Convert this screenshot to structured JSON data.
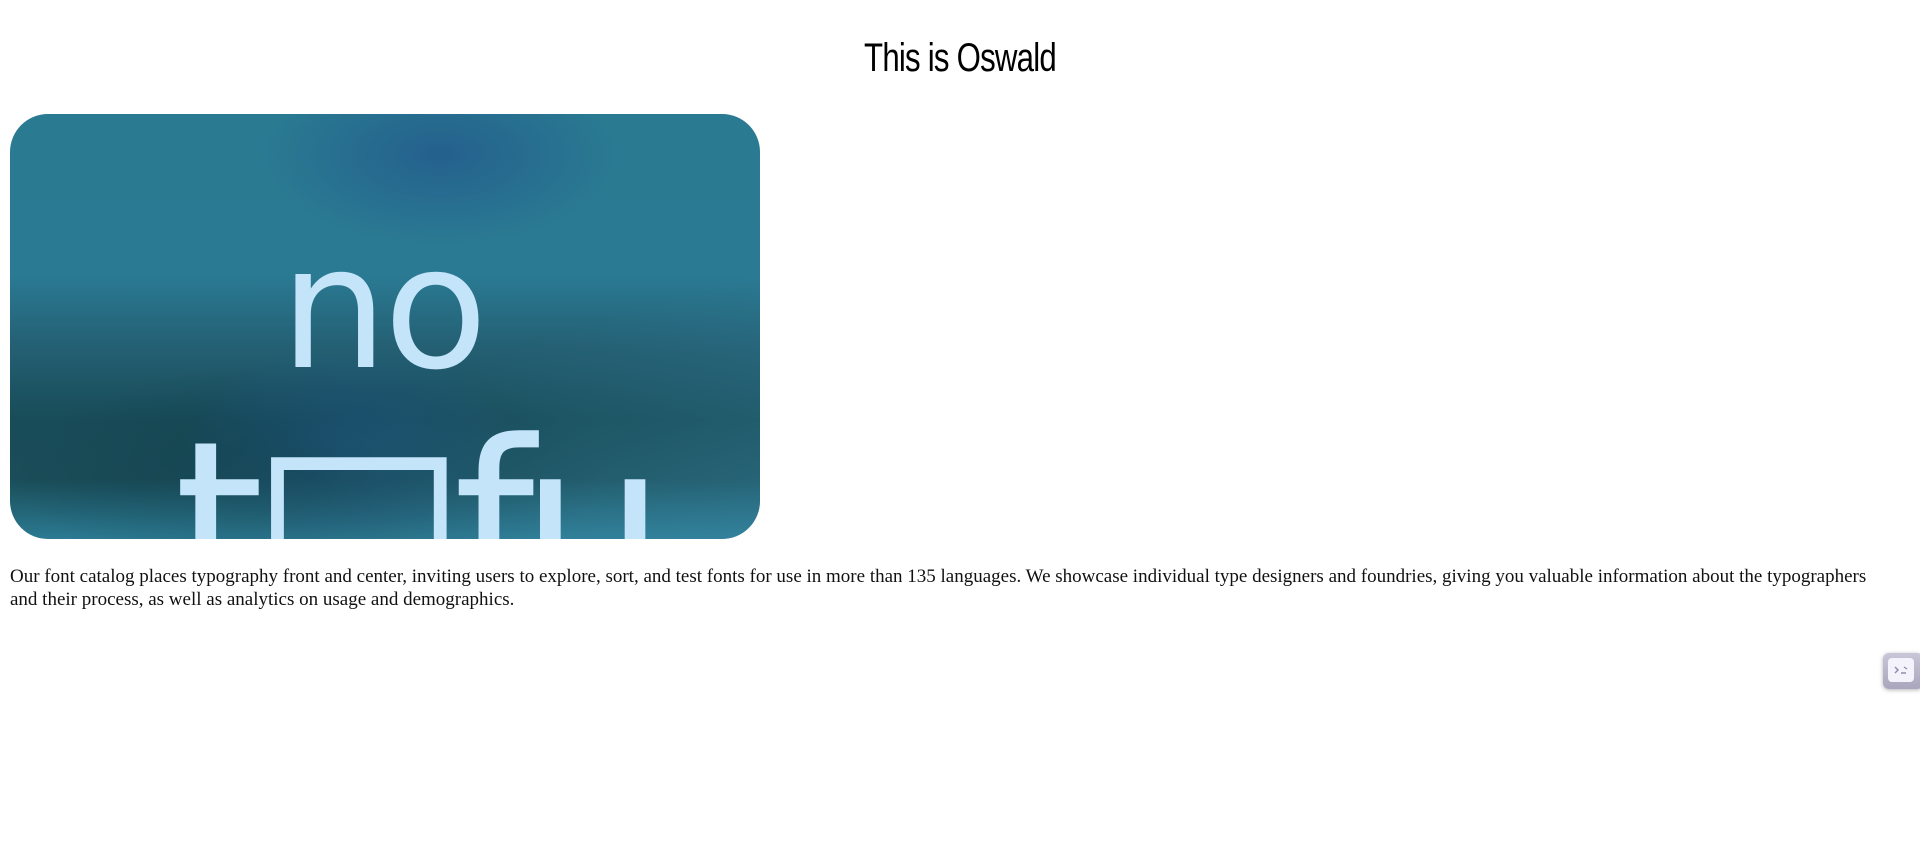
{
  "page": {
    "title": "This is Oswald"
  },
  "hero": {
    "line1": "no",
    "line2": "t□fu"
  },
  "content": {
    "paragraph": "Our font catalog places typography front and center, inviting users to explore, sort, and test fonts for use in more than 135 languages. We showcase individual type designers and foundries, giving you valuable information about the typographers and their process, as well as analytics on usage and demographics."
  },
  "widget": {
    "icon": "terminal-icon"
  },
  "colors": {
    "hero_text": "#c3e4f9",
    "hero_bg": "#2a7b92"
  }
}
